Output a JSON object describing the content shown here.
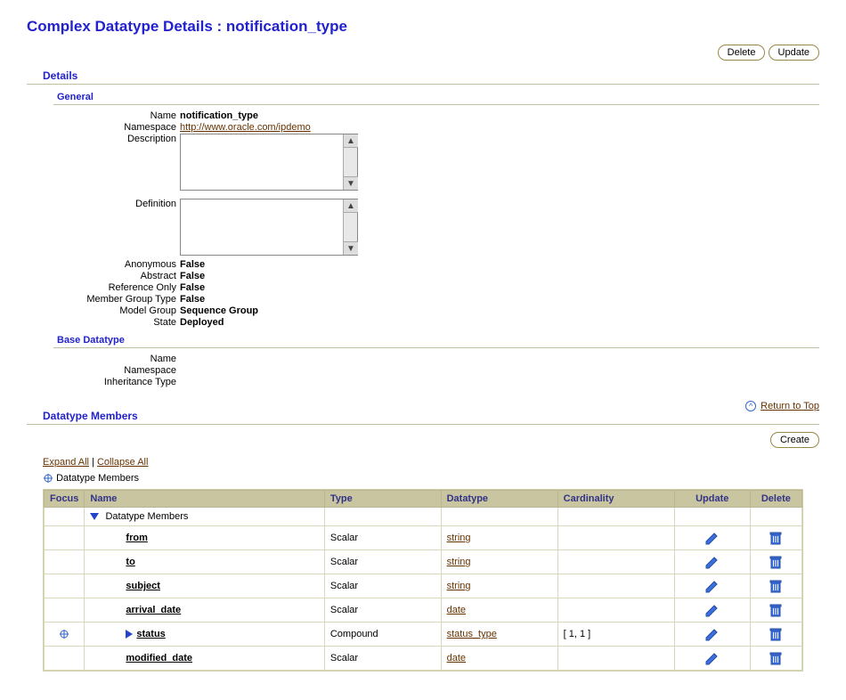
{
  "page": {
    "title": "Complex Datatype Details : notification_type",
    "buttons": {
      "delete": "Delete",
      "update": "Update",
      "create": "Create"
    }
  },
  "sections": {
    "details": "Details",
    "general": "General",
    "base": "Base Datatype",
    "members": "Datatype Members"
  },
  "general": {
    "labels": {
      "name": "Name",
      "namespace": "Namespace",
      "description": "Description",
      "definition": "Definition",
      "anonymous": "Anonymous",
      "abstract": "Abstract",
      "refonly": "Reference Only",
      "mgt": "Member Group Type",
      "modelgroup": "Model Group",
      "state": "State"
    },
    "values": {
      "name": "notification_type",
      "namespace": "http://www.oracle.com/ipdemo",
      "description": "",
      "definition": "",
      "anonymous": "False",
      "abstract": "False",
      "refonly": "False",
      "mgt": "False",
      "modelgroup": "Sequence Group",
      "state": "Deployed"
    }
  },
  "base": {
    "labels": {
      "name": "Name",
      "namespace": "Namespace",
      "inh": "Inheritance Type"
    },
    "values": {
      "name": "",
      "namespace": "",
      "inh": ""
    }
  },
  "links": {
    "returnTop": "Return to Top",
    "expandAll": "Expand All",
    "collapseAll": "Collapse All"
  },
  "tree": {
    "root": "Datatype Members"
  },
  "table": {
    "headers": {
      "focus": "Focus",
      "name": "Name",
      "type": "Type",
      "datatype": "Datatype",
      "cardinality": "Cardinality",
      "update": "Update",
      "delete": "Delete"
    },
    "rootRow": "Datatype Members",
    "rows": [
      {
        "name": "from",
        "type": "Scalar",
        "datatype": "string",
        "cardinality": "",
        "compound": false,
        "focus": false
      },
      {
        "name": "to",
        "type": "Scalar",
        "datatype": "string",
        "cardinality": "",
        "compound": false,
        "focus": false
      },
      {
        "name": "subject",
        "type": "Scalar",
        "datatype": "string",
        "cardinality": "",
        "compound": false,
        "focus": false
      },
      {
        "name": "arrival_date",
        "type": "Scalar",
        "datatype": "date",
        "cardinality": "",
        "compound": false,
        "focus": false
      },
      {
        "name": "status",
        "type": "Compound",
        "datatype": "status_type",
        "cardinality": "[ 1, 1 ]",
        "compound": true,
        "focus": true
      },
      {
        "name": "modified_date",
        "type": "Scalar",
        "datatype": "date",
        "cardinality": "",
        "compound": false,
        "focus": false
      }
    ]
  }
}
